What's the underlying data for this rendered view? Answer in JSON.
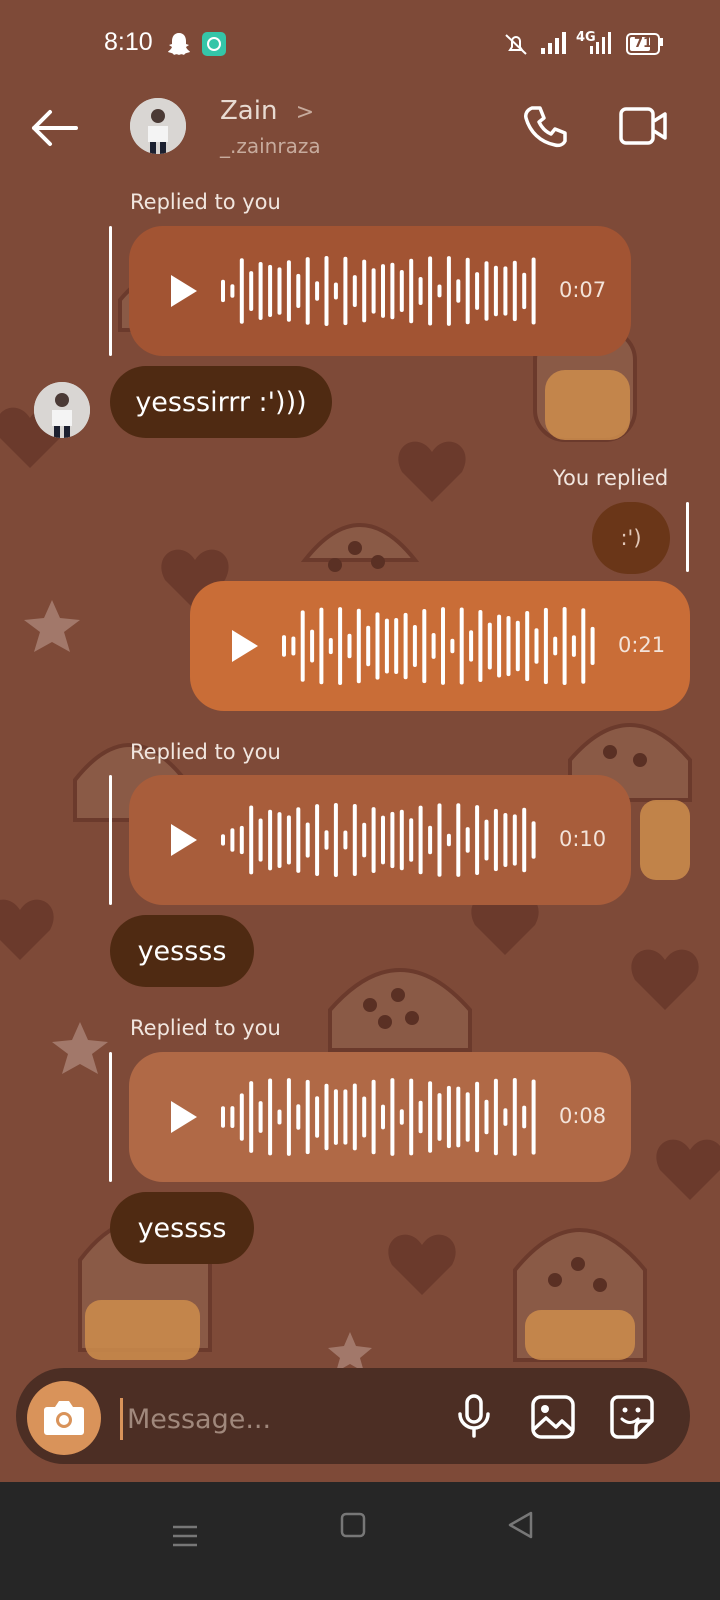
{
  "status_bar": {
    "time": "8:10",
    "battery": "71",
    "network": "4G"
  },
  "header": {
    "name": "Zain",
    "chevron": ">",
    "username": "_.zainraza"
  },
  "messages": [
    {
      "label": "Replied to you",
      "duration": "0:07",
      "text": "yesssirrr :')))"
    },
    {
      "label": "You replied",
      "reaction": ":')",
      "duration": "0:21"
    },
    {
      "label": "Replied to you",
      "duration": "0:10",
      "text": "yessss"
    },
    {
      "label": "Replied to you",
      "duration": "0:08",
      "text": "yessss"
    }
  ],
  "composer": {
    "placeholder": "Message..."
  },
  "colors": {
    "background": "#7e4a38",
    "incoming_text_bubble": "#4f2a12",
    "outgoing_voice": "#c96d37",
    "accent": "#d9935a"
  },
  "icons": [
    "snapchat-icon",
    "notification-icon",
    "mute-icon",
    "signal-icon",
    "battery-icon",
    "back-arrow-icon",
    "phone-icon",
    "video-call-icon",
    "play-icon",
    "camera-icon",
    "microphone-icon",
    "gallery-icon",
    "sticker-icon",
    "menu-nav-icon",
    "home-nav-icon",
    "back-nav-icon"
  ]
}
